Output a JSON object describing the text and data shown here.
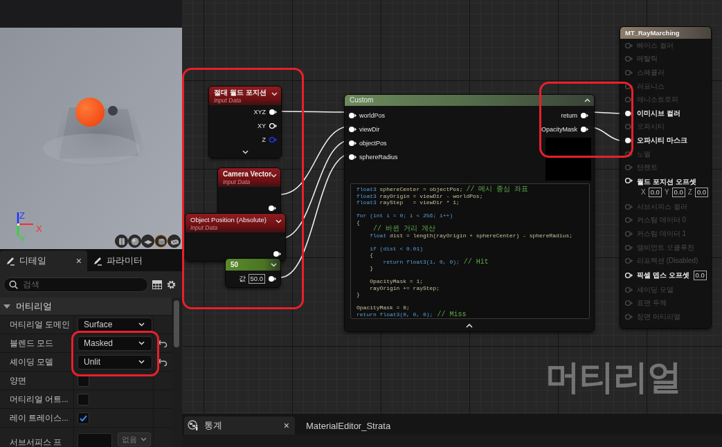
{
  "viewport": {
    "gizmo": {
      "x": "X",
      "y": "Y",
      "z": "Z"
    },
    "preview_shapes": [
      {
        "kind": "cylinder",
        "selected": false
      },
      {
        "kind": "sphere",
        "selected": false
      },
      {
        "kind": "plane",
        "selected": false
      },
      {
        "kind": "cube",
        "selected": true
      },
      {
        "kind": "teapot",
        "selected": false
      }
    ]
  },
  "details_panel": {
    "tabs": [
      {
        "label": "디테일",
        "selected": true,
        "close": "×"
      },
      {
        "label": "파라미터",
        "selected": false
      }
    ],
    "search": {
      "placeholder": "검색"
    },
    "category": {
      "label": "머티리얼",
      "expanded": true
    },
    "properties": [
      {
        "label": "머티리얼 도메인",
        "kind": "dropdown",
        "value": "Surface",
        "modified": false
      },
      {
        "label": "블렌드 모드",
        "kind": "dropdown",
        "value": "Masked",
        "modified": true
      },
      {
        "label": "셰이딩 모델",
        "kind": "dropdown",
        "value": "Unlit",
        "modified": true
      },
      {
        "label": "양면",
        "kind": "checkbox",
        "checked": false
      },
      {
        "label": "머티리얼 어트...",
        "kind": "checkbox",
        "checked": false
      },
      {
        "label": "레이 트레이스...",
        "kind": "checkbox",
        "checked": true
      },
      {
        "label": "서브서피스 프",
        "kind": "color",
        "value": "없음"
      }
    ]
  },
  "graph": {
    "nodes": [
      {
        "kind": "input",
        "title": "절대 월드 포지션",
        "subtitle": "Input Data",
        "expandable": true,
        "pins": [
          {
            "label": "XYZ",
            "connected": true,
            "color": "#ffffff"
          },
          {
            "label": "XY",
            "connected": false,
            "color": "#ffffff"
          },
          {
            "label": "Z",
            "connected": false,
            "color": "#1f3cff"
          }
        ]
      },
      {
        "kind": "input",
        "title": "Camera Vector",
        "subtitle": "Input Data",
        "expandable": false,
        "pins": [
          {
            "connected": true,
            "color": "#ffffff"
          }
        ]
      },
      {
        "kind": "input",
        "title": "Object Position (Absolute)",
        "subtitle": "Input Data",
        "expandable": false,
        "pins": [
          {
            "connected": true,
            "color": "#ffffff"
          }
        ]
      },
      {
        "kind": "constant",
        "title": "50",
        "value_label": "값",
        "value": "50.0",
        "pins": [
          {
            "connected": true,
            "color": "#ffffff"
          }
        ]
      }
    ],
    "custom_node": {
      "title": "Custom",
      "inputs": [
        "worldPos",
        "viewDir",
        "objectPos",
        "sphereRadius"
      ],
      "outputs": [
        "return",
        "OpacityMask"
      ],
      "code": [
        [
          [
            {
              "kind": "keyword",
              "text": "float3"
            },
            {
              "kind": "code",
              "text": " sphereCenter = objectPos; "
            },
            {
              "kind": "comment",
              "text": "// 메시 중심 좌표"
            }
          ],
          [
            {
              "kind": "keyword",
              "text": "float3"
            },
            {
              "kind": "code",
              "text": " rayOrigin = viewDir - worldPos;"
            }
          ],
          [
            {
              "kind": "keyword",
              "text": "float3"
            },
            {
              "kind": "code",
              "text": " rayStep   = viewDir * 1;"
            }
          ]
        ],
        [
          [
            {
              "kind": "keyword",
              "text": "for (int i = 0; i < 256; i++)"
            }
          ],
          [
            {
              "kind": "code",
              "text": "{"
            }
          ],
          [
            {
              "kind": "comment",
              "text": "    // 바뀐 거리 계산"
            }
          ],
          [
            {
              "kind": "keyword",
              "text": "    float"
            },
            {
              "kind": "code",
              "text": " dist = length(rayOrigin + sphereCenter) - sphereRadius;"
            }
          ]
        ],
        [
          [
            {
              "kind": "keyword",
              "text": "    if (dist < 0.01)"
            }
          ],
          [
            {
              "kind": "code",
              "text": "    {"
            }
          ],
          [
            {
              "kind": "keyword",
              "text": "        return float3(1, 0, 0);"
            },
            {
              "kind": "comment",
              "text": " // Hit"
            }
          ],
          [
            {
              "kind": "code",
              "text": "    }"
            }
          ]
        ],
        [
          [
            {
              "kind": "code",
              "text": "    OpacityMask = 1;"
            }
          ],
          [
            {
              "kind": "code",
              "text": "    rayOrigin += rayStep;"
            }
          ],
          [
            {
              "kind": "code",
              "text": "}"
            }
          ]
        ],
        [
          [
            {
              "kind": "code",
              "text": "OpacityMask = 0;"
            }
          ],
          [
            {
              "kind": "keyword",
              "text": "return float3(0, 0, 0);"
            },
            {
              "kind": "comment",
              "text": " // Miss"
            }
          ]
        ]
      ]
    },
    "result_node": {
      "title": "MT_RayMarching",
      "pins": [
        {
          "label": "베이스 컬러",
          "enabled": false,
          "connected": false
        },
        {
          "label": "메탈릭",
          "enabled": false,
          "connected": false
        },
        {
          "label": "스페큘러",
          "enabled": false,
          "connected": false
        },
        {
          "label": "러프니스",
          "enabled": false,
          "connected": false
        },
        {
          "label": "애니소트로피",
          "enabled": false,
          "connected": false
        },
        {
          "label": "이미시브 컬러",
          "enabled": true,
          "connected": true
        },
        {
          "label": "오파시티",
          "enabled": false,
          "connected": false
        },
        {
          "label": "오파시티 마스크",
          "enabled": true,
          "connected": true
        },
        {
          "label": "노멀",
          "enabled": false,
          "connected": false
        },
        {
          "label": "탄젠트",
          "enabled": false,
          "connected": false
        },
        {
          "label": "월드 포지션 오프셋",
          "enabled": true,
          "connected": false,
          "fields": [
            {
              "axis": "X",
              "value": "0.0"
            },
            {
              "axis": "Y",
              "value": "0.0"
            },
            {
              "axis": "Z",
              "value": "0.0"
            }
          ]
        },
        {
          "label": "서브서피스 컬러",
          "enabled": false,
          "connected": false
        },
        {
          "label": "커스텀 데이터 0",
          "enabled": false,
          "connected": false
        },
        {
          "label": "커스텀 데이터 1",
          "enabled": false,
          "connected": false
        },
        {
          "label": "앰비언트 오클루전",
          "enabled": false,
          "connected": false
        },
        {
          "label": "리프랙션 (Disabled)",
          "enabled": false,
          "connected": false
        },
        {
          "label": "픽셀 뎁스 오프셋",
          "enabled": true,
          "connected": false,
          "fields": [
            {
              "value": "0.0"
            }
          ]
        },
        {
          "label": "셰이딩 모델",
          "enabled": false,
          "connected": false
        },
        {
          "label": "표면 두께",
          "enabled": false,
          "connected": false
        },
        {
          "label": "정면 머티리얼",
          "enabled": false,
          "connected": false
        }
      ]
    },
    "watermark": "머티리얼"
  },
  "bottom_bar": {
    "tabs": [
      {
        "label": "통계",
        "selected": true,
        "close": "×"
      },
      {
        "label": "MaterialEditor_Strata",
        "selected": false
      }
    ]
  }
}
